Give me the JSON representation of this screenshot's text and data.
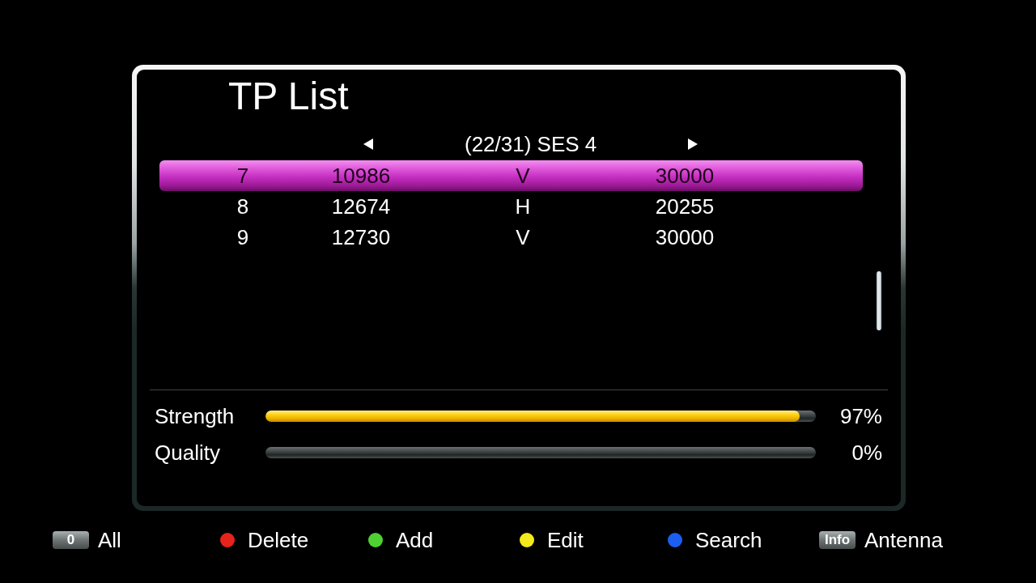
{
  "screen": {
    "title": "TP List"
  },
  "satellite_selector": {
    "label": "(22/31) SES 4"
  },
  "transponders": [
    {
      "cells": [
        "7",
        "10986",
        "V",
        "30000"
      ],
      "selected": true
    },
    {
      "cells": [
        "8",
        "12674",
        "H",
        "20255"
      ],
      "selected": false
    },
    {
      "cells": [
        "9",
        "12730",
        "V",
        "30000"
      ],
      "selected": false
    }
  ],
  "signal": [
    {
      "label": "Strength",
      "level": 0.97,
      "reading": "97%"
    },
    {
      "label": "Quality",
      "level": 0,
      "reading": "0%"
    }
  ],
  "legend": [
    {
      "kind": "key",
      "key": "0",
      "label": "All"
    },
    {
      "kind": "dot",
      "color": "#e8231b",
      "label": "Delete"
    },
    {
      "kind": "dot",
      "color": "#4fd132",
      "label": "Add"
    },
    {
      "kind": "dot",
      "color": "#f3e91c",
      "label": "Edit"
    },
    {
      "kind": "dot",
      "color": "#1c5ef0",
      "label": "Search"
    },
    {
      "kind": "key",
      "key": "Info",
      "label": "Antenna"
    }
  ]
}
